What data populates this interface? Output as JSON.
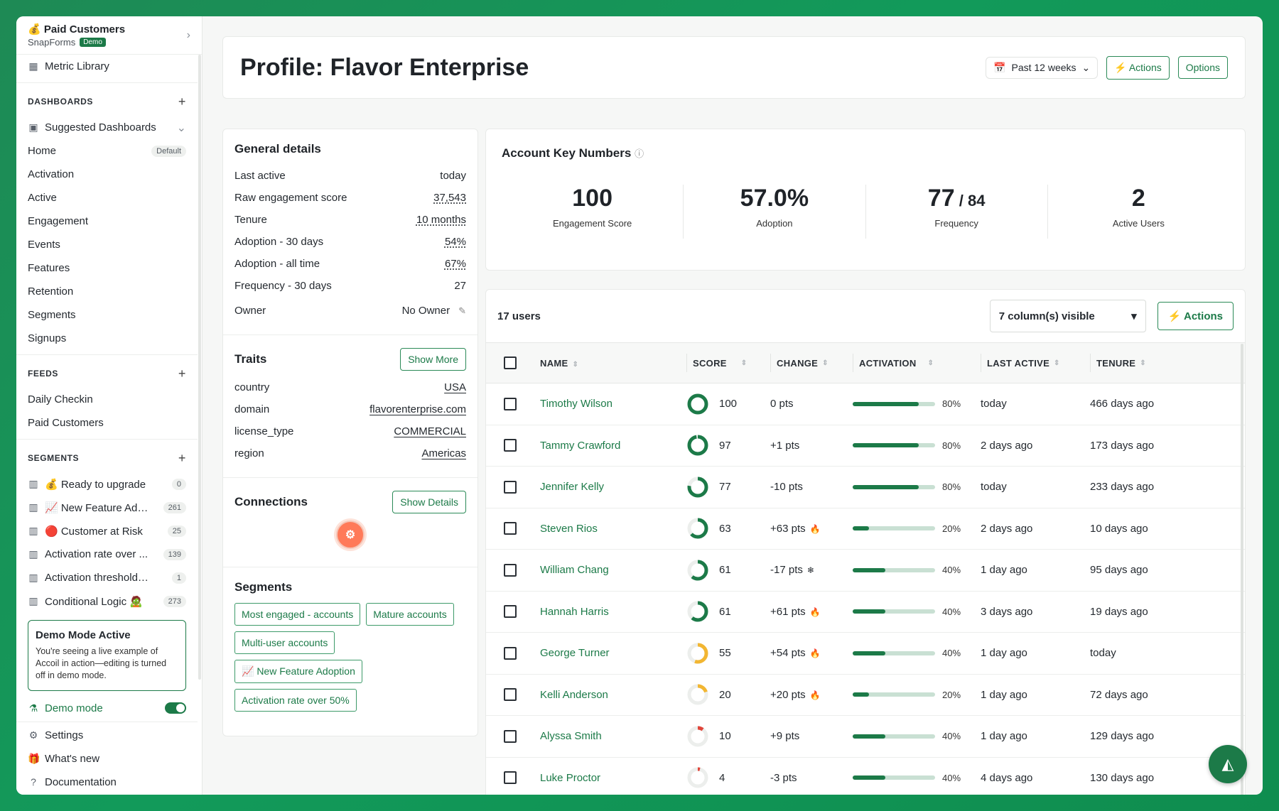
{
  "workspace": {
    "name": "Paid Customers",
    "emoji": "💰",
    "org": "SnapForms",
    "badge": "Demo"
  },
  "sidebar": {
    "metric_library": "Metric Library",
    "dashboards_header": "DASHBOARDS",
    "dashboards": [
      {
        "label": "Suggested Dashboards"
      },
      {
        "label": "Home",
        "badge": "Default"
      },
      {
        "label": "Activation"
      },
      {
        "label": "Active"
      },
      {
        "label": "Engagement"
      },
      {
        "label": "Events"
      },
      {
        "label": "Features"
      },
      {
        "label": "Retention"
      },
      {
        "label": "Segments"
      },
      {
        "label": "Signups"
      }
    ],
    "feeds_header": "FEEDS",
    "feeds": [
      {
        "label": "Daily Checkin"
      },
      {
        "label": "Paid Customers"
      }
    ],
    "segments_header": "SEGMENTS",
    "segments": [
      {
        "label": "💰 Ready to upgrade",
        "count": "0"
      },
      {
        "label": "📈 New Feature Ado...",
        "count": "261"
      },
      {
        "label": "🔴 Customer at Risk",
        "count": "25"
      },
      {
        "label": "Activation rate over ...",
        "count": "139"
      },
      {
        "label": "Activation threshold m...",
        "count": "1"
      },
      {
        "label": "Conditional Logic 🧟",
        "count": "273"
      }
    ],
    "demo_card": {
      "title": "Demo Mode Active",
      "text": "You're seeing a live example of Accoil in action—editing is turned off in demo mode."
    },
    "demo_mode_label": "Demo mode",
    "footer": [
      {
        "label": "Settings"
      },
      {
        "label": "What's new"
      },
      {
        "label": "Documentation"
      }
    ]
  },
  "header": {
    "title": "Profile: Flavor Enterprise",
    "period": "Past 12 weeks",
    "actions": "⚡ Actions",
    "options": "Options"
  },
  "general": {
    "title": "General details",
    "rows": [
      {
        "label": "Last active",
        "value": "today"
      },
      {
        "label": "Raw engagement score",
        "value": "37,543"
      },
      {
        "label": "Tenure",
        "value": "10 months"
      },
      {
        "label": "Adoption - 30 days",
        "value": "54%"
      },
      {
        "label": "Adoption - all time",
        "value": "67%"
      },
      {
        "label": "Frequency - 30 days",
        "value": "27"
      },
      {
        "label": "Owner",
        "value": "No Owner"
      }
    ]
  },
  "traits": {
    "title": "Traits",
    "button": "Show More",
    "rows": [
      {
        "label": "country",
        "value": "USA"
      },
      {
        "label": "domain",
        "value": "flavorenterprise.com"
      },
      {
        "label": "license_type",
        "value": "COMMERCIAL"
      },
      {
        "label": "region",
        "value": "Americas"
      }
    ]
  },
  "connections": {
    "title": "Connections",
    "button": "Show Details"
  },
  "segments_panel": {
    "title": "Segments",
    "chips": [
      "Most engaged - accounts",
      "Mature accounts",
      "Multi-user accounts",
      "📈 New Feature Adoption",
      "Activation rate over 50%"
    ]
  },
  "key_numbers": {
    "title": "Account Key Numbers",
    "items": [
      {
        "value": "100",
        "suffix": "",
        "label": "Engagement Score"
      },
      {
        "value": "57.0%",
        "suffix": "",
        "label": "Adoption"
      },
      {
        "value": "77",
        "suffix": " / 84",
        "label": "Frequency"
      },
      {
        "value": "2",
        "suffix": "",
        "label": "Active Users"
      }
    ]
  },
  "users": {
    "count_label": "17 users",
    "columns_visible": "7 column(s) visible",
    "actions": "⚡ Actions",
    "headers": [
      "NAME",
      "SCORE",
      "CHANGE",
      "ACTIVATION",
      "LAST ACTIVE",
      "TENURE"
    ],
    "rows": [
      {
        "name": "Timothy Wilson",
        "score": "100",
        "change": "0 pts",
        "change_icon": "",
        "activation": 80,
        "activation_label": "80%",
        "last_active": "today",
        "tenure": "466 days ago",
        "ring_color": "#1c7a48"
      },
      {
        "name": "Tammy Crawford",
        "score": "97",
        "change": "+1 pts",
        "change_icon": "",
        "activation": 80,
        "activation_label": "80%",
        "last_active": "2 days ago",
        "tenure": "173 days ago",
        "ring_color": "#1c7a48"
      },
      {
        "name": "Jennifer Kelly",
        "score": "77",
        "change": "-10 pts",
        "change_icon": "",
        "activation": 80,
        "activation_label": "80%",
        "last_active": "today",
        "tenure": "233 days ago",
        "ring_color": "#1c7a48"
      },
      {
        "name": "Steven Rios",
        "score": "63",
        "change": "+63 pts",
        "change_icon": "🔥",
        "activation": 20,
        "activation_label": "20%",
        "last_active": "2 days ago",
        "tenure": "10 days ago",
        "ring_color": "#1c7a48"
      },
      {
        "name": "William Chang",
        "score": "61",
        "change": "-17 pts",
        "change_icon": "❄",
        "activation": 40,
        "activation_label": "40%",
        "last_active": "1 day ago",
        "tenure": "95 days ago",
        "ring_color": "#1c7a48"
      },
      {
        "name": "Hannah Harris",
        "score": "61",
        "change": "+61 pts",
        "change_icon": "🔥",
        "activation": 40,
        "activation_label": "40%",
        "last_active": "3 days ago",
        "tenure": "19 days ago",
        "ring_color": "#1c7a48"
      },
      {
        "name": "George Turner",
        "score": "55",
        "change": "+54 pts",
        "change_icon": "🔥",
        "activation": 40,
        "activation_label": "40%",
        "last_active": "1 day ago",
        "tenure": "today",
        "ring_color": "#f2b632"
      },
      {
        "name": "Kelli Anderson",
        "score": "20",
        "change": "+20 pts",
        "change_icon": "🔥",
        "activation": 20,
        "activation_label": "20%",
        "last_active": "1 day ago",
        "tenure": "72 days ago",
        "ring_color": "#f2b632"
      },
      {
        "name": "Alyssa Smith",
        "score": "10",
        "change": "+9 pts",
        "change_icon": "",
        "activation": 40,
        "activation_label": "40%",
        "last_active": "1 day ago",
        "tenure": "129 days ago",
        "ring_color": "#e0453a"
      },
      {
        "name": "Luke Proctor",
        "score": "4",
        "change": "-3 pts",
        "change_icon": "",
        "activation": 40,
        "activation_label": "40%",
        "last_active": "4 days ago",
        "tenure": "130 days ago",
        "ring_color": "#e0453a"
      }
    ]
  },
  "colors": {
    "brand": "#1c7a48",
    "background": "#129a5a"
  }
}
